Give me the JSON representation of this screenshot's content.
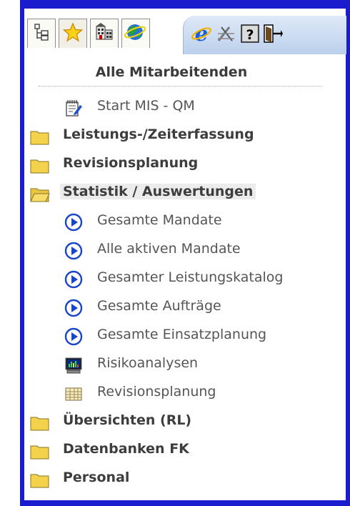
{
  "header": {
    "title": "Alle Mitarbeitenden"
  },
  "tabs": [
    {
      "icon": "tree-view-icon",
      "active": false
    },
    {
      "icon": "favorites-star-icon",
      "active": true
    },
    {
      "icon": "building-icon",
      "active": false
    },
    {
      "icon": "globe-network-icon",
      "active": false
    }
  ],
  "toolbar": [
    {
      "icon": "internet-explorer-icon"
    },
    {
      "icon": "settings-tools-icon"
    },
    {
      "icon": "help-icon",
      "glyph": "?"
    },
    {
      "icon": "exit-door-icon"
    }
  ],
  "tree": {
    "start": {
      "label": "Start MIS - QM",
      "icon": "notepad-pencil-icon"
    },
    "folder_leistung": {
      "label": "Leistungs-/Zeiterfassung"
    },
    "folder_revision": {
      "label": "Revisionsplanung"
    },
    "folder_statistik": {
      "label": "Statistik / Auswertungen",
      "items": [
        {
          "label": "Gesamte Mandate",
          "icon": "play-circle-icon"
        },
        {
          "label": "Alle aktiven Mandate",
          "icon": "play-circle-icon"
        },
        {
          "label": "Gesamter Leistungskatalog",
          "icon": "play-circle-icon"
        },
        {
          "label": "Gesamte Aufträge",
          "icon": "play-circle-icon"
        },
        {
          "label": "Gesamte Einsatzplanung",
          "icon": "play-circle-icon"
        },
        {
          "label": "Risikoanalysen",
          "icon": "monitor-chart-icon"
        },
        {
          "label": "Revisionsplanung",
          "icon": "spreadsheet-icon"
        }
      ]
    },
    "folder_uebersichten": {
      "label": "Übersichten (RL)"
    },
    "folder_datenbanken": {
      "label": "Datenbanken FK"
    },
    "folder_personal": {
      "label": "Personal"
    }
  },
  "colors": {
    "frame": "#1c1ccf",
    "folder": "#f4d24c",
    "text_bold": "#3d3d3d",
    "text_item": "#555555",
    "play": "#1b45c9"
  }
}
